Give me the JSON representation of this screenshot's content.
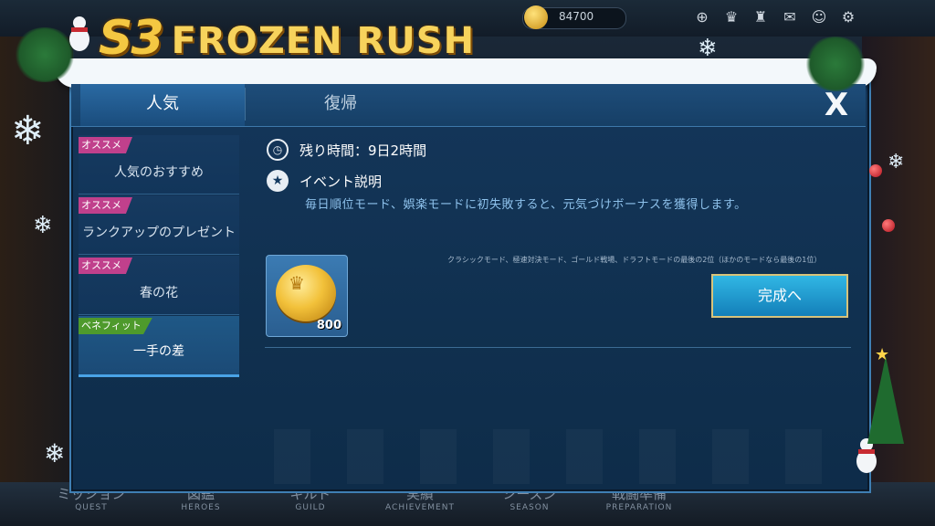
{
  "background": {
    "coin_balance": "84700",
    "nav": [
      {
        "jp": "ミッション",
        "en": "QUEST"
      },
      {
        "jp": "図鑑",
        "en": "HEROES"
      },
      {
        "jp": "ギルド",
        "en": "GUILD"
      },
      {
        "jp": "実績",
        "en": "ACHIEVEMENT"
      },
      {
        "jp": "シーズン",
        "en": "SEASON"
      },
      {
        "jp": "戦闘準備",
        "en": "PREPARATION"
      }
    ],
    "icons": [
      "plus-icon",
      "trophy-icon",
      "castle-icon",
      "mail-icon",
      "friends-icon",
      "gear-icon"
    ]
  },
  "banner": {
    "season": "S3",
    "title": "FROZEN RUSH"
  },
  "tabs": [
    {
      "label": "人気",
      "active": true
    },
    {
      "label": "復帰",
      "active": false
    }
  ],
  "close_label": "X",
  "sidebar": {
    "items": [
      {
        "tag": "オススメ",
        "tag_color": "#c0408c",
        "label": "人気のおすすめ",
        "active": false
      },
      {
        "tag": "オススメ",
        "tag_color": "#c0408c",
        "label": "ランクアップのプレゼント",
        "active": false
      },
      {
        "tag": "オススメ",
        "tag_color": "#c0408c",
        "label": "春の花",
        "active": false
      },
      {
        "tag": "ベネフィット",
        "tag_color": "#4e9a2c",
        "label": "一手の差",
        "active": true
      }
    ]
  },
  "content": {
    "time_label": "残り時間：9日2時間",
    "event_heading": "イベント説明",
    "description": "毎日順位モード、娯楽モードに初失敗すると、元気づけボーナスを獲得します。",
    "note": "クラシックモード、極速対決モード、ゴールド戦場、ドラフトモードの最後の2位（ほかのモードなら最後の1位）",
    "reward_count": "800",
    "reward_icon": "gold-coin-icon",
    "complete_button": "完成へ"
  },
  "colors": {
    "accent": "#31b7e4",
    "gold": "#f4c842",
    "description": "#8ec2ec"
  }
}
